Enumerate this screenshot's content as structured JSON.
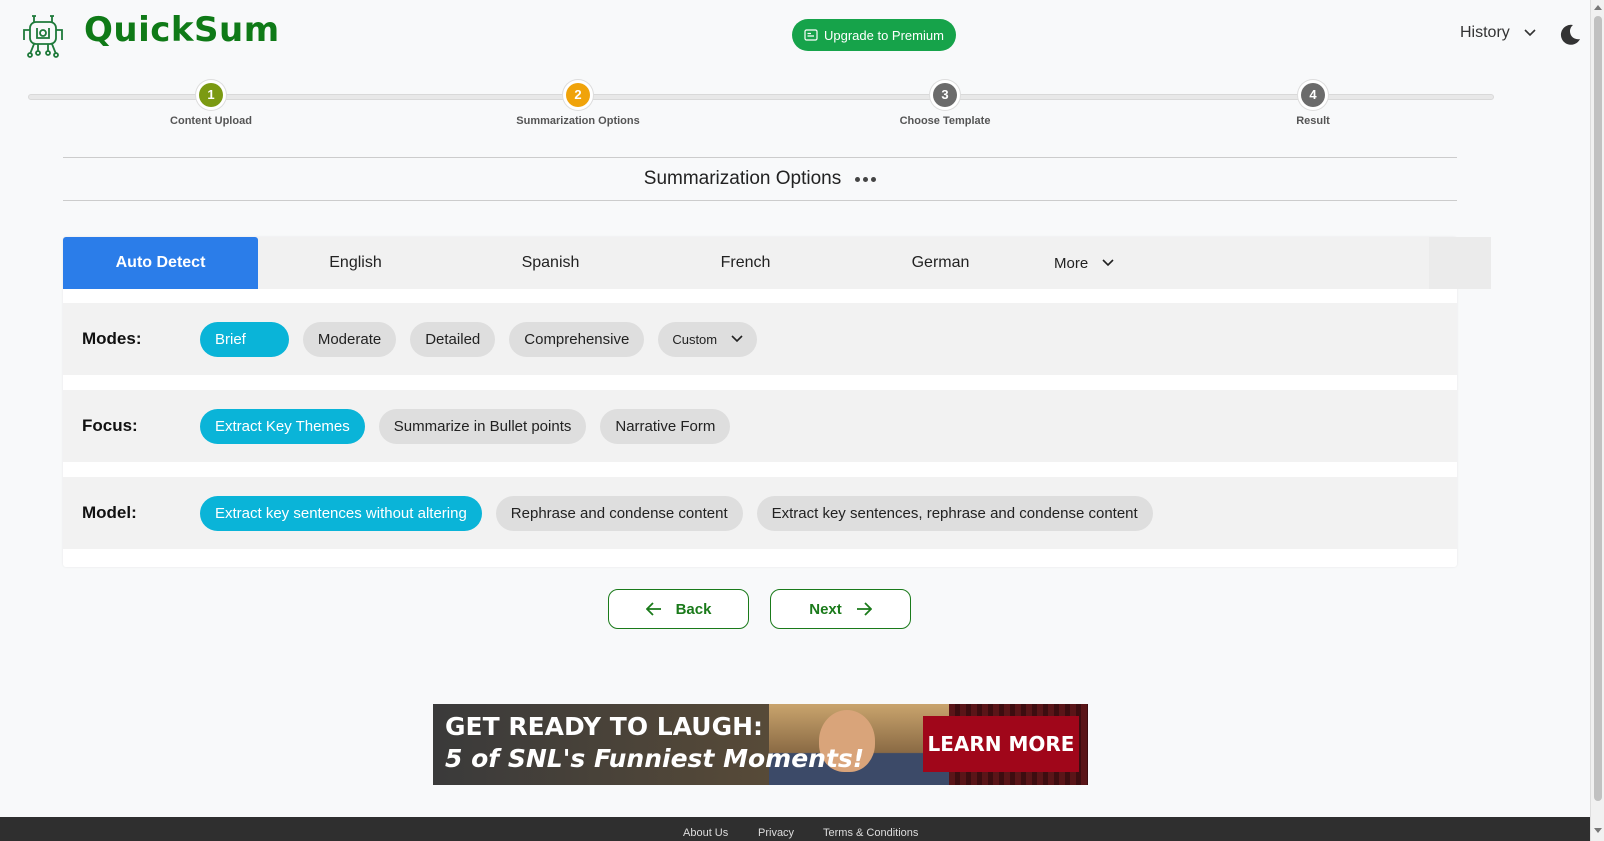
{
  "header": {
    "brand": "QuickSum",
    "premium_label": "Upgrade to Premium",
    "history_label": "History"
  },
  "stepper": {
    "steps": [
      {
        "number": "1",
        "label": "Content Upload",
        "color": "#7b9a12"
      },
      {
        "number": "2",
        "label": "Summarization Options",
        "color": "#f0a30a"
      },
      {
        "number": "3",
        "label": "Choose Template",
        "color": "#6b6b6b"
      },
      {
        "number": "4",
        "label": "Result",
        "color": "#6b6b6b"
      }
    ]
  },
  "section": {
    "title": "Summarization Options"
  },
  "languages": {
    "tabs": [
      "Auto Detect",
      "English",
      "Spanish",
      "French",
      "German"
    ],
    "more_label": "More",
    "active": "Auto Detect"
  },
  "options": {
    "modes": {
      "label": "Modes:",
      "items": [
        "Brief",
        "Moderate",
        "Detailed",
        "Comprehensive"
      ],
      "custom_label": "Custom",
      "selected": "Brief"
    },
    "focus": {
      "label": "Focus:",
      "items": [
        "Extract Key Themes",
        "Summarize in Bullet points",
        "Narrative Form"
      ],
      "selected": "Extract Key Themes"
    },
    "model": {
      "label": "Model:",
      "items": [
        "Extract key sentences without altering",
        "Rephrase and condense content",
        "Extract key sentences, rephrase and condense content"
      ],
      "selected": "Extract key sentences without altering"
    }
  },
  "nav": {
    "back_label": "Back",
    "next_label": "Next"
  },
  "ad": {
    "headline": "GET READY TO LAUGH:",
    "subline": "5 of SNL's Funniest Moments!",
    "cta": "LEARN MORE"
  },
  "footer": {
    "links": [
      "About Us",
      "Privacy",
      "Terms & Conditions"
    ]
  },
  "colors": {
    "brand_green": "#0f7a17",
    "active_tab": "#2b7de9",
    "selected_pill": "#0ab4d8"
  }
}
